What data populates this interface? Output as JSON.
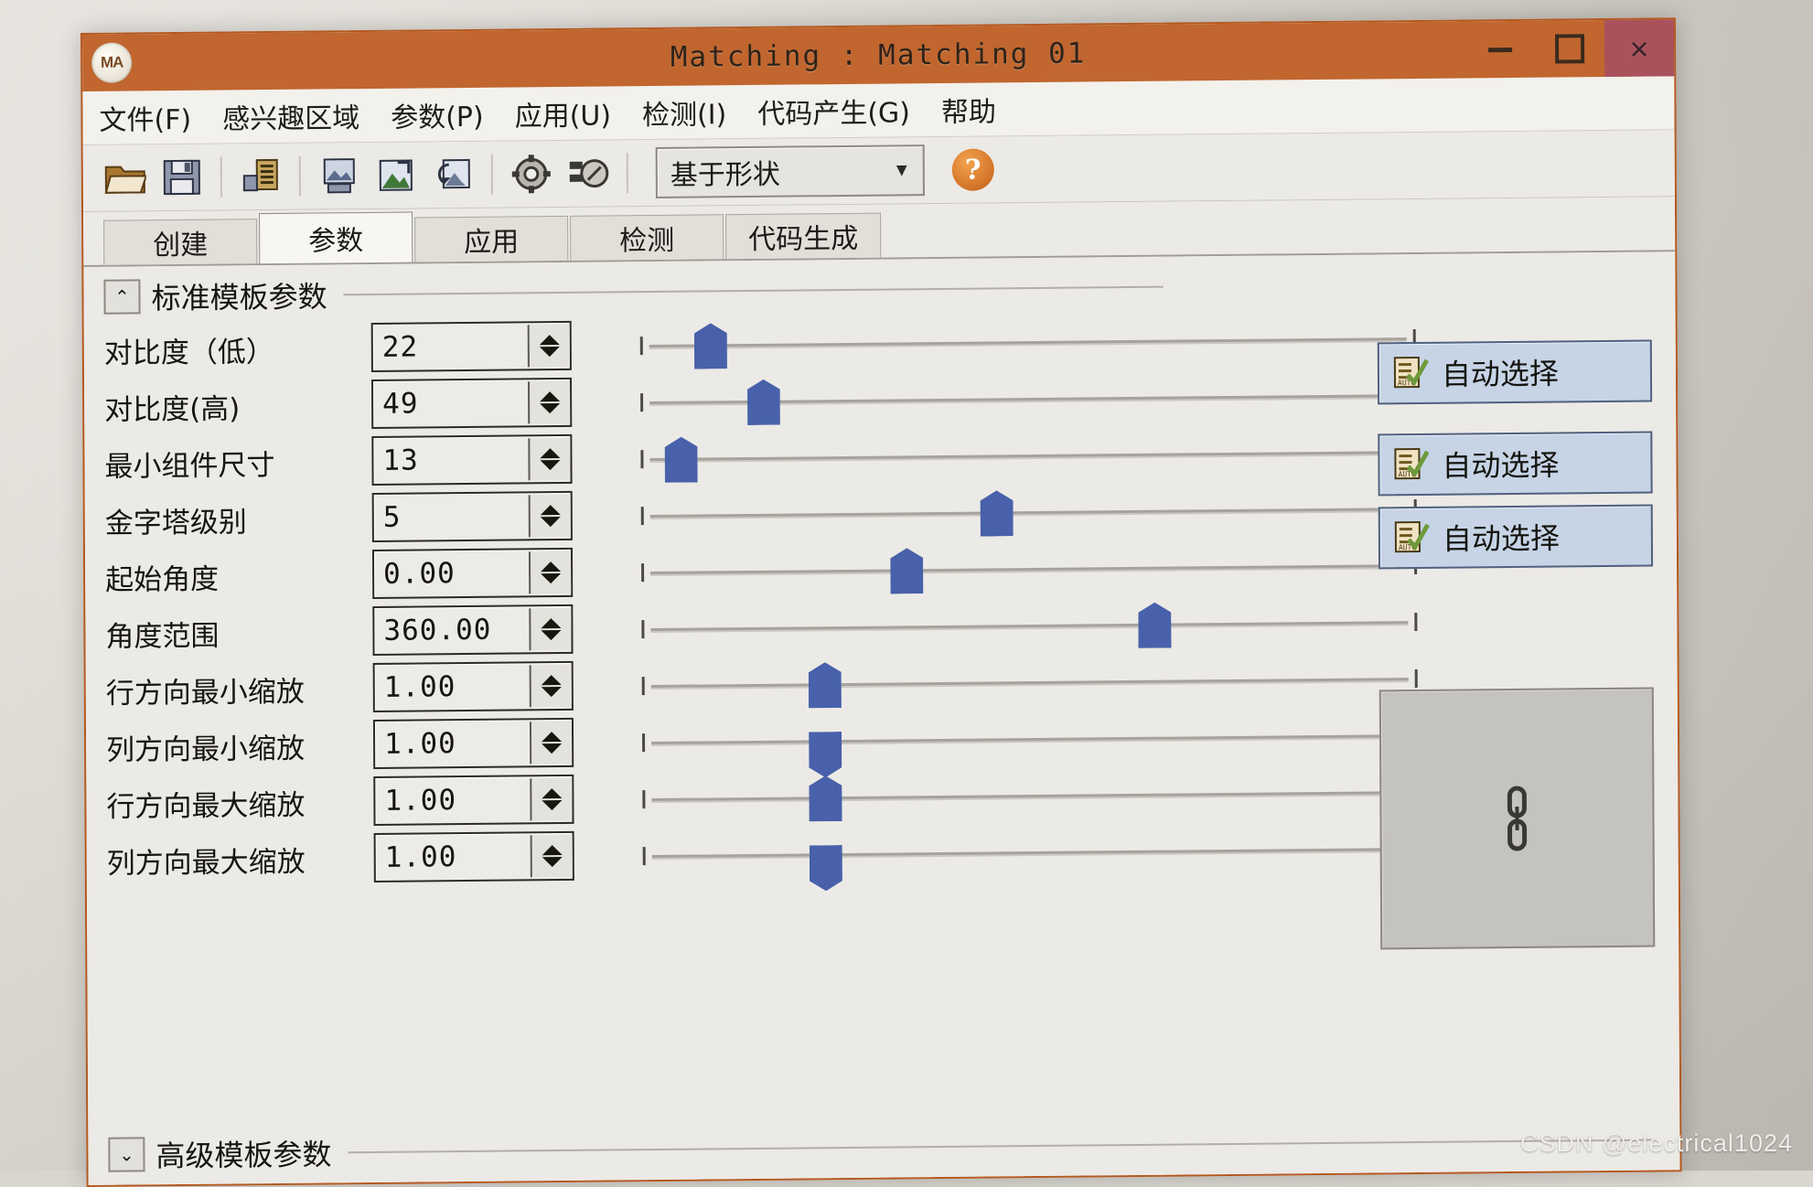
{
  "window": {
    "title": "Matching : Matching 01",
    "logo_text": "MA",
    "controls": {
      "minimize": "–",
      "maximize": "□",
      "close": "×"
    }
  },
  "menubar": {
    "items": [
      {
        "label": "文件(F)"
      },
      {
        "label": "感兴趣区域"
      },
      {
        "label": "参数(P)"
      },
      {
        "label": "应用(U)"
      },
      {
        "label": "检测(I)"
      },
      {
        "label": "代码产生(G)"
      },
      {
        "label": "帮助"
      }
    ]
  },
  "toolbar": {
    "icons": [
      {
        "name": "open-folder-icon"
      },
      {
        "name": "save-icon"
      },
      {
        "name": "save-parameters-icon"
      },
      {
        "name": "save-image-icon"
      },
      {
        "name": "load-image-icon"
      },
      {
        "name": "refresh-image-icon"
      },
      {
        "name": "settings-gear-icon"
      },
      {
        "name": "inspect-icon"
      }
    ],
    "method_combo": {
      "value": "基于形状",
      "arrow": "▼"
    },
    "help_label": "?"
  },
  "tabs": [
    {
      "label": "创建",
      "active": false
    },
    {
      "label": "参数",
      "active": true
    },
    {
      "label": "应用",
      "active": false
    },
    {
      "label": "检测",
      "active": false
    },
    {
      "label": "代码生成",
      "active": false
    }
  ],
  "standard_group": {
    "title": "标准模板参数",
    "collapse_icon": "⌃",
    "rows": [
      {
        "label": "对比度（低）",
        "value": "22",
        "thumb_pct": 6,
        "dual": false
      },
      {
        "label": "对比度(高)",
        "value": "49",
        "thumb_pct": 13,
        "dual": false
      },
      {
        "label": "最小组件尺寸",
        "value": "13",
        "thumb_pct": 2,
        "dual": false
      },
      {
        "label": "金字塔级别",
        "value": "5",
        "thumb_pct": 44,
        "dual": false
      },
      {
        "label": "起始角度",
        "value": "0.00",
        "thumb_pct": 32,
        "dual": false
      },
      {
        "label": "角度范围",
        "value": "360.00",
        "thumb_pct": 65,
        "dual": false
      },
      {
        "label": "行方向最小缩放",
        "value": "1.00",
        "thumb_pct": 21,
        "dual": "up"
      },
      {
        "label": "列方向最小缩放",
        "value": "1.00",
        "thumb_pct": 21,
        "dual": "down"
      },
      {
        "label": "行方向最大缩放",
        "value": "1.00",
        "thumb_pct": 21,
        "dual": "up"
      },
      {
        "label": "列方向最大缩放",
        "value": "1.00",
        "thumb_pct": 21,
        "dual": "down"
      }
    ]
  },
  "auto_buttons": [
    {
      "label": "自动选择"
    },
    {
      "label": "自动选择"
    },
    {
      "label": "自动选择"
    }
  ],
  "preview": {
    "icon": "chain-link-icon"
  },
  "advanced_group": {
    "title": "高级模板参数",
    "collapse_icon": "⌄"
  },
  "watermark": "CSDN @electrical1024"
}
